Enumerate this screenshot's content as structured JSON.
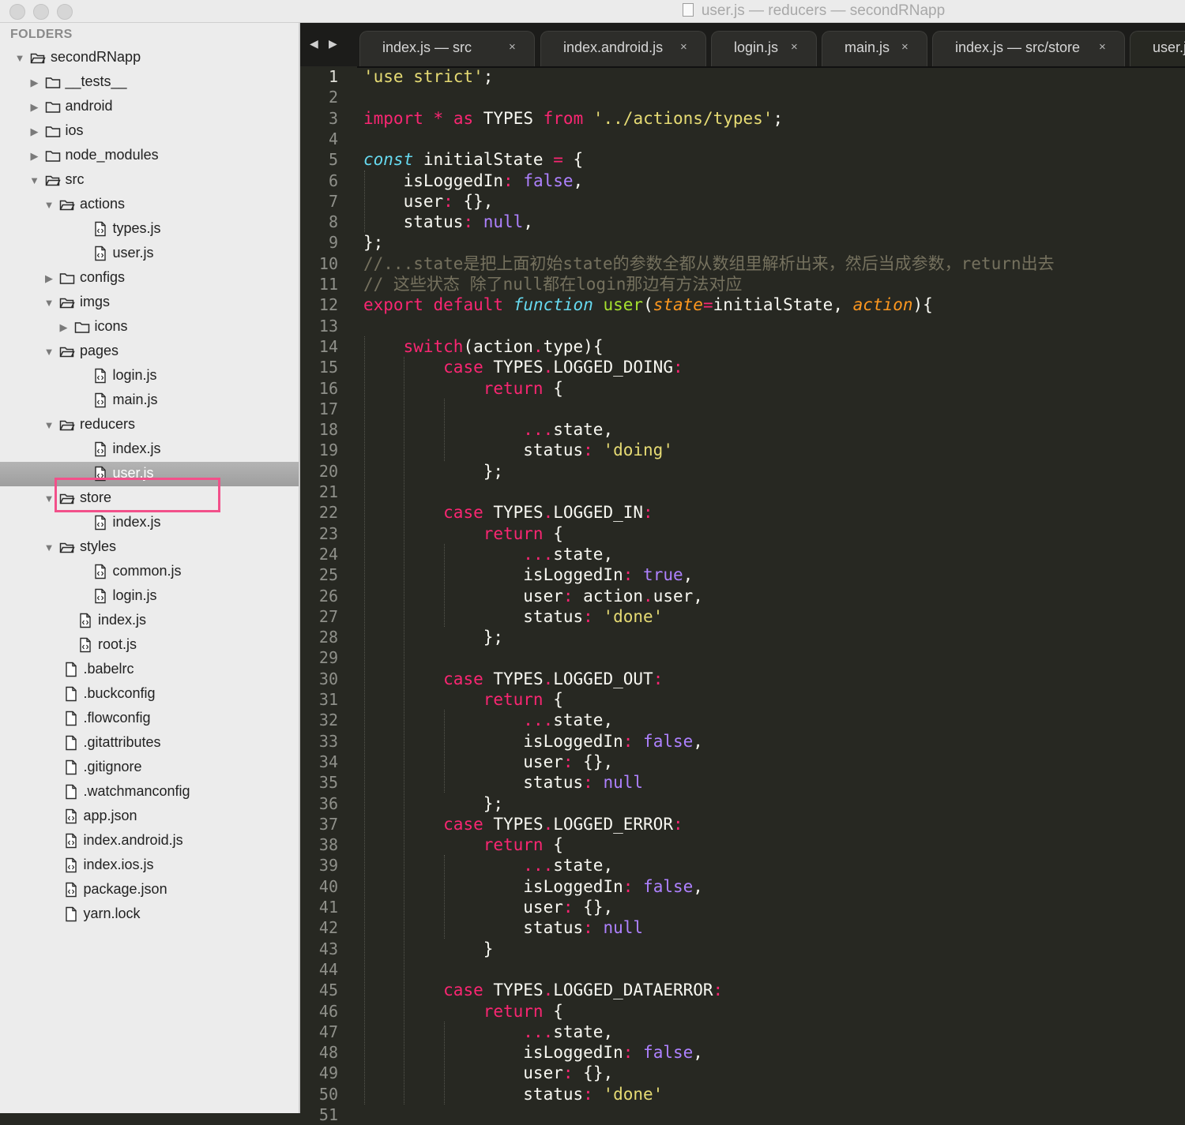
{
  "window": {
    "title": "user.js — reducers — secondRNapp"
  },
  "sidebar": {
    "header": "FOLDERS",
    "items": [
      {
        "label": "secondRNapp",
        "type": "folder",
        "depth": 0,
        "open": true
      },
      {
        "label": "__tests__",
        "type": "folder",
        "depth": 1,
        "open": false
      },
      {
        "label": "android",
        "type": "folder",
        "depth": 1,
        "open": false
      },
      {
        "label": "ios",
        "type": "folder",
        "depth": 1,
        "open": false
      },
      {
        "label": "node_modules",
        "type": "folder",
        "depth": 1,
        "open": false
      },
      {
        "label": "src",
        "type": "folder",
        "depth": 1,
        "open": true
      },
      {
        "label": "actions",
        "type": "folder",
        "depth": 2,
        "open": true
      },
      {
        "label": "types.js",
        "type": "js",
        "depth": 3
      },
      {
        "label": "user.js",
        "type": "js",
        "depth": 3
      },
      {
        "label": "configs",
        "type": "folder",
        "depth": 2,
        "open": false
      },
      {
        "label": "imgs",
        "type": "folder",
        "depth": 2,
        "open": true
      },
      {
        "label": "icons",
        "type": "folder",
        "depth": 3,
        "open": false
      },
      {
        "label": "pages",
        "type": "folder",
        "depth": 2,
        "open": true
      },
      {
        "label": "login.js",
        "type": "js",
        "depth": 3
      },
      {
        "label": "main.js",
        "type": "js",
        "depth": 3
      },
      {
        "label": "reducers",
        "type": "folder",
        "depth": 2,
        "open": true
      },
      {
        "label": "index.js",
        "type": "js",
        "depth": 3
      },
      {
        "label": "user.js",
        "type": "js",
        "depth": 3,
        "selected": true
      },
      {
        "label": "store",
        "type": "folder",
        "depth": 2,
        "open": true
      },
      {
        "label": "index.js",
        "type": "js",
        "depth": 3
      },
      {
        "label": "styles",
        "type": "folder",
        "depth": 2,
        "open": true
      },
      {
        "label": "common.js",
        "type": "js",
        "depth": 3
      },
      {
        "label": "login.js",
        "type": "js",
        "depth": 3
      },
      {
        "label": "index.js",
        "type": "js",
        "depth": 2
      },
      {
        "label": "root.js",
        "type": "js",
        "depth": 2
      },
      {
        "label": ".babelrc",
        "type": "file",
        "depth": 1
      },
      {
        "label": ".buckconfig",
        "type": "file",
        "depth": 1
      },
      {
        "label": ".flowconfig",
        "type": "file",
        "depth": 1
      },
      {
        "label": ".gitattributes",
        "type": "file",
        "depth": 1
      },
      {
        "label": ".gitignore",
        "type": "file",
        "depth": 1
      },
      {
        "label": ".watchmanconfig",
        "type": "file",
        "depth": 1
      },
      {
        "label": "app.json",
        "type": "js",
        "depth": 1
      },
      {
        "label": "index.android.js",
        "type": "js",
        "depth": 1
      },
      {
        "label": "index.ios.js",
        "type": "js",
        "depth": 1
      },
      {
        "label": "package.json",
        "type": "js",
        "depth": 1
      },
      {
        "label": "yarn.lock",
        "type": "file",
        "depth": 1
      }
    ]
  },
  "tabs": [
    {
      "label": "index.js — src",
      "close": "×"
    },
    {
      "label": "index.android.js",
      "close": "×"
    },
    {
      "label": "login.js",
      "close": "×"
    },
    {
      "label": "main.js",
      "close": "×"
    },
    {
      "label": "index.js — src/store",
      "close": "×"
    },
    {
      "label": "user.js",
      "close": "×",
      "active": true
    }
  ],
  "editor": {
    "current_line": 1,
    "lines": [
      [
        [
          "'use strict'",
          "st"
        ],
        [
          ";",
          ""
        ]
      ],
      [],
      [
        [
          "import",
          "kw"
        ],
        [
          " ",
          ""
        ],
        [
          "*",
          "kw"
        ],
        [
          " ",
          ""
        ],
        [
          "as",
          "kw"
        ],
        [
          " TYPES ",
          ""
        ],
        [
          "from",
          "kw"
        ],
        [
          " ",
          ""
        ],
        [
          "'../actions/types'",
          "st"
        ],
        [
          ";",
          ""
        ]
      ],
      [],
      [
        [
          "const",
          "sp"
        ],
        [
          " initialState ",
          ""
        ],
        [
          "=",
          "kw"
        ],
        [
          " {",
          ""
        ]
      ],
      [
        [
          "    isLoggedIn",
          ""
        ],
        [
          ":",
          "kw"
        ],
        [
          " ",
          ""
        ],
        [
          "false",
          "cn"
        ],
        [
          ",",
          ""
        ]
      ],
      [
        [
          "    user",
          ""
        ],
        [
          ":",
          "kw"
        ],
        [
          " {},",
          ""
        ]
      ],
      [
        [
          "    status",
          ""
        ],
        [
          ":",
          "kw"
        ],
        [
          " ",
          ""
        ],
        [
          "null",
          "cn"
        ],
        [
          ",",
          ""
        ]
      ],
      [
        [
          "};",
          ""
        ]
      ],
      [
        [
          "//...state是把上面初始state的参数全都从数组里解析出来，然后当成参数，return出去",
          "cm"
        ]
      ],
      [
        [
          "// 这些状态 除了null都在login那边有方法对应",
          "cm"
        ]
      ],
      [
        [
          "export",
          "kw"
        ],
        [
          " ",
          ""
        ],
        [
          "default",
          "kw"
        ],
        [
          " ",
          ""
        ],
        [
          "function",
          "sp"
        ],
        [
          " ",
          ""
        ],
        [
          "user",
          "fn"
        ],
        [
          "(",
          ""
        ],
        [
          "state",
          "pr"
        ],
        [
          "=",
          "kw"
        ],
        [
          "initialState, ",
          ""
        ],
        [
          "action",
          "pr"
        ],
        [
          "){",
          ""
        ]
      ],
      [],
      [
        [
          "    ",
          ""
        ],
        [
          "switch",
          "kw"
        ],
        [
          "(action",
          ""
        ],
        [
          ".",
          "kw"
        ],
        [
          "type){",
          ""
        ]
      ],
      [
        [
          "        ",
          ""
        ],
        [
          "case",
          "kw"
        ],
        [
          " TYPES",
          ""
        ],
        [
          ".",
          "kw"
        ],
        [
          "LOGGED_DOING",
          ""
        ],
        [
          ":",
          "kw"
        ]
      ],
      [
        [
          "            ",
          ""
        ],
        [
          "return",
          "kw"
        ],
        [
          " {",
          ""
        ]
      ],
      [],
      [
        [
          "                ",
          ""
        ],
        [
          "...",
          "kw"
        ],
        [
          "state,",
          ""
        ]
      ],
      [
        [
          "                status",
          ""
        ],
        [
          ":",
          "kw"
        ],
        [
          " ",
          ""
        ],
        [
          "'doing'",
          "st"
        ]
      ],
      [
        [
          "            };",
          ""
        ]
      ],
      [],
      [
        [
          "        ",
          ""
        ],
        [
          "case",
          "kw"
        ],
        [
          " TYPES",
          ""
        ],
        [
          ".",
          "kw"
        ],
        [
          "LOGGED_IN",
          ""
        ],
        [
          ":",
          "kw"
        ]
      ],
      [
        [
          "            ",
          ""
        ],
        [
          "return",
          "kw"
        ],
        [
          " {",
          ""
        ]
      ],
      [
        [
          "                ",
          ""
        ],
        [
          "...",
          "kw"
        ],
        [
          "state,",
          ""
        ]
      ],
      [
        [
          "                isLoggedIn",
          ""
        ],
        [
          ":",
          "kw"
        ],
        [
          " ",
          ""
        ],
        [
          "true",
          "cn"
        ],
        [
          ",",
          ""
        ]
      ],
      [
        [
          "                user",
          ""
        ],
        [
          ":",
          "kw"
        ],
        [
          " action",
          ""
        ],
        [
          ".",
          "kw"
        ],
        [
          "user,",
          ""
        ]
      ],
      [
        [
          "                status",
          ""
        ],
        [
          ":",
          "kw"
        ],
        [
          " ",
          ""
        ],
        [
          "'done'",
          "st"
        ]
      ],
      [
        [
          "            };",
          ""
        ]
      ],
      [],
      [
        [
          "        ",
          ""
        ],
        [
          "case",
          "kw"
        ],
        [
          " TYPES",
          ""
        ],
        [
          ".",
          "kw"
        ],
        [
          "LOGGED_OUT",
          ""
        ],
        [
          ":",
          "kw"
        ]
      ],
      [
        [
          "            ",
          ""
        ],
        [
          "return",
          "kw"
        ],
        [
          " {",
          ""
        ]
      ],
      [
        [
          "                ",
          ""
        ],
        [
          "...",
          "kw"
        ],
        [
          "state,",
          ""
        ]
      ],
      [
        [
          "                isLoggedIn",
          ""
        ],
        [
          ":",
          "kw"
        ],
        [
          " ",
          ""
        ],
        [
          "false",
          "cn"
        ],
        [
          ",",
          ""
        ]
      ],
      [
        [
          "                user",
          ""
        ],
        [
          ":",
          "kw"
        ],
        [
          " {},",
          ""
        ]
      ],
      [
        [
          "                status",
          ""
        ],
        [
          ":",
          "kw"
        ],
        [
          " ",
          ""
        ],
        [
          "null",
          "cn"
        ]
      ],
      [
        [
          "            };",
          ""
        ]
      ],
      [
        [
          "        ",
          ""
        ],
        [
          "case",
          "kw"
        ],
        [
          " TYPES",
          ""
        ],
        [
          ".",
          "kw"
        ],
        [
          "LOGGED_ERROR",
          ""
        ],
        [
          ":",
          "kw"
        ]
      ],
      [
        [
          "            ",
          ""
        ],
        [
          "return",
          "kw"
        ],
        [
          " {",
          ""
        ]
      ],
      [
        [
          "                ",
          ""
        ],
        [
          "...",
          "kw"
        ],
        [
          "state,",
          ""
        ]
      ],
      [
        [
          "                isLoggedIn",
          ""
        ],
        [
          ":",
          "kw"
        ],
        [
          " ",
          ""
        ],
        [
          "false",
          "cn"
        ],
        [
          ",",
          ""
        ]
      ],
      [
        [
          "                user",
          ""
        ],
        [
          ":",
          "kw"
        ],
        [
          " {},",
          ""
        ]
      ],
      [
        [
          "                status",
          ""
        ],
        [
          ":",
          "kw"
        ],
        [
          " ",
          ""
        ],
        [
          "null",
          "cn"
        ]
      ],
      [
        [
          "            }",
          ""
        ]
      ],
      [],
      [
        [
          "        ",
          ""
        ],
        [
          "case",
          "kw"
        ],
        [
          " TYPES",
          ""
        ],
        [
          ".",
          "kw"
        ],
        [
          "LOGGED_DATAERROR",
          ""
        ],
        [
          ":",
          "kw"
        ]
      ],
      [
        [
          "            ",
          ""
        ],
        [
          "return",
          "kw"
        ],
        [
          " {",
          ""
        ]
      ],
      [
        [
          "                ",
          ""
        ],
        [
          "...",
          "kw"
        ],
        [
          "state,",
          ""
        ]
      ],
      [
        [
          "                isLoggedIn",
          ""
        ],
        [
          ":",
          "kw"
        ],
        [
          " ",
          ""
        ],
        [
          "false",
          "cn"
        ],
        [
          ",",
          ""
        ]
      ],
      [
        [
          "                user",
          ""
        ],
        [
          ":",
          "kw"
        ],
        [
          " {},",
          ""
        ]
      ],
      [
        [
          "                status",
          ""
        ],
        [
          ":",
          "kw"
        ],
        [
          " ",
          ""
        ],
        [
          "'done'",
          "st"
        ]
      ]
    ]
  },
  "colors": {
    "highlight_box": "#f2508a",
    "editor_bg": "#272822",
    "sidebar_bg": "#ececec"
  }
}
